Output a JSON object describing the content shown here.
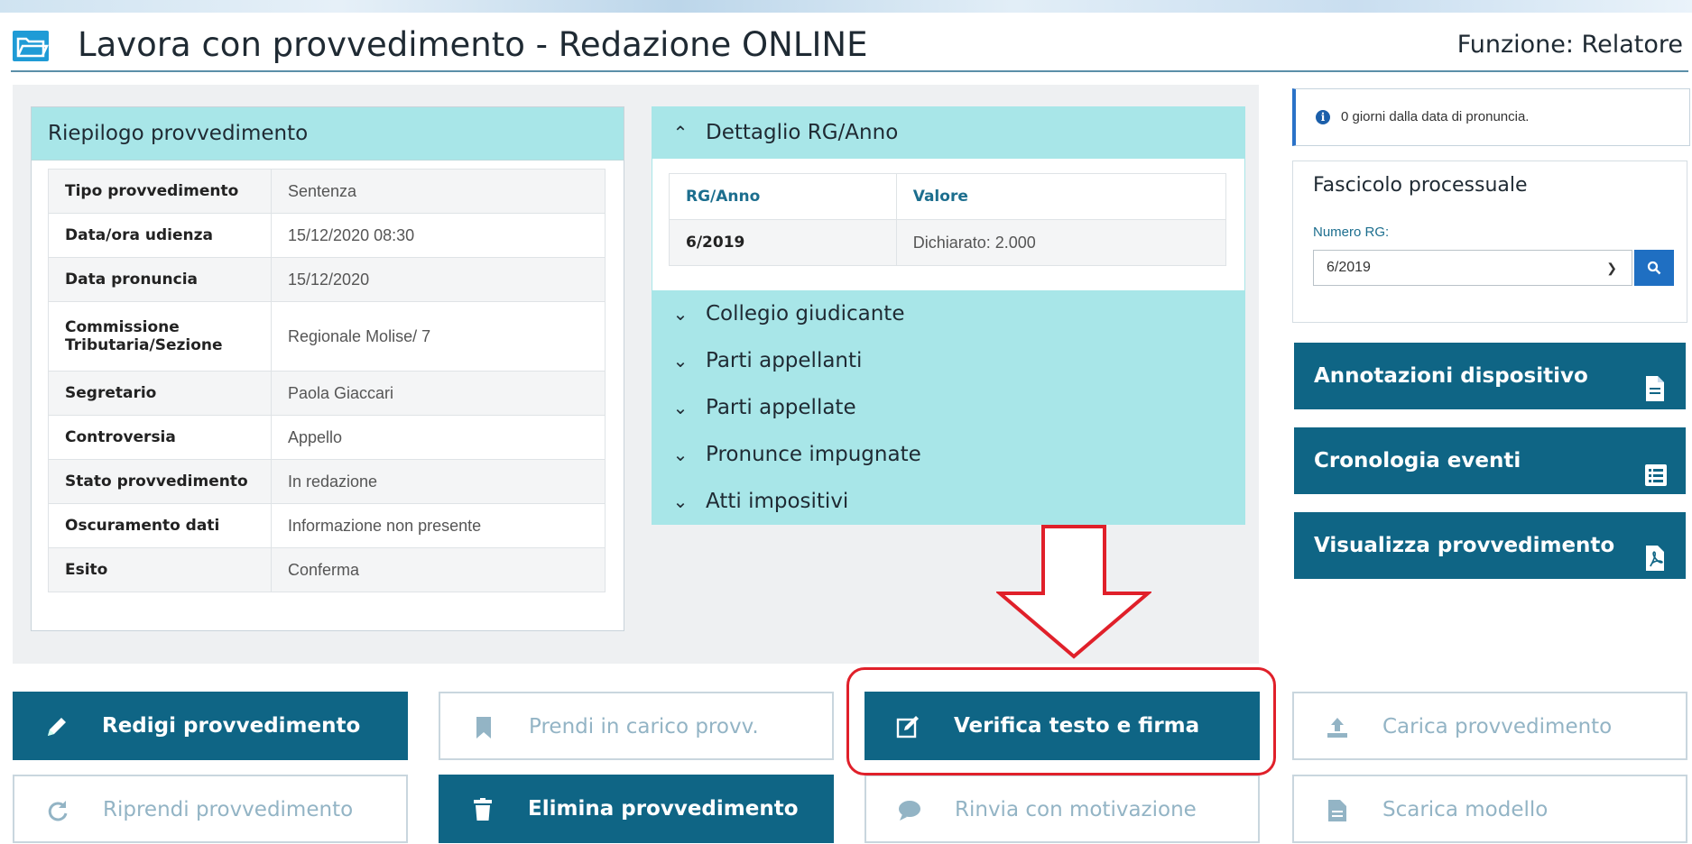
{
  "header": {
    "title": "Lavora con provvedimento - Redazione ONLINE",
    "role": "Funzione: Relatore"
  },
  "summary": {
    "title": "Riepilogo provvedimento",
    "rows": [
      {
        "label": "Tipo provvedimento",
        "value": "Sentenza"
      },
      {
        "label": "Data/ora udienza",
        "value": "15/12/2020 08:30"
      },
      {
        "label": "Data pronuncia",
        "value": "15/12/2020"
      },
      {
        "label": "Commissione Tributaria/Sezione",
        "value": "Regionale Molise/ 7"
      },
      {
        "label": "Segretario",
        "value": "Paola Giaccari"
      },
      {
        "label": "Controversia",
        "value": "Appello"
      },
      {
        "label": "Stato provvedimento",
        "value": "In redazione"
      },
      {
        "label": "Oscuramento dati",
        "value": "Informazione non presente"
      },
      {
        "label": "Esito",
        "value": "Conferma"
      }
    ]
  },
  "detail": {
    "open_section": "Dettaglio RG/Anno",
    "table": {
      "headers": [
        "RG/Anno",
        "Valore"
      ],
      "rows": [
        [
          "6/2019",
          "Dichiarato: 2.000"
        ]
      ]
    },
    "closed_sections": [
      "Collegio giudicante",
      "Parti appellanti",
      "Parti appellate",
      "Pronunce impugnate",
      "Atti impositivi"
    ]
  },
  "info": {
    "message": "0 giorni dalla data di pronuncia."
  },
  "fascicolo": {
    "title": "Fascicolo processuale",
    "rg_label": "Numero RG:",
    "rg_value": "6/2019"
  },
  "side_buttons": {
    "annotazioni": "Annotazioni dispositivo",
    "cronologia": "Cronologia eventi",
    "visualizza": "Visualizza provvedimento"
  },
  "actions": {
    "redigi": "Redigi provvedimento",
    "prendi": "Prendi in carico provv.",
    "verifica": "Verifica testo e firma",
    "carica": "Carica provvedimento",
    "riprendi": "Riprendi provvedimento",
    "elimina": "Elimina provvedimento",
    "rinvia": "Rinvia con motivazione",
    "scarica": "Scarica modello"
  },
  "colors": {
    "primary": "#0f6585",
    "accordion": "#a8e6e8",
    "disabled_text": "#93b4c5",
    "highlight": "#e0202a"
  },
  "icons": {
    "folder": "folder-icon",
    "search": "search-icon",
    "document": "document-icon",
    "list": "list-icon",
    "pdf": "pdf-icon",
    "pencil": "pencil-icon",
    "bookmark": "bookmark-icon",
    "edit": "edit-icon",
    "upload": "upload-icon",
    "redo": "redo-icon",
    "trash": "trash-icon",
    "comment": "comment-icon",
    "file": "file-icon"
  }
}
